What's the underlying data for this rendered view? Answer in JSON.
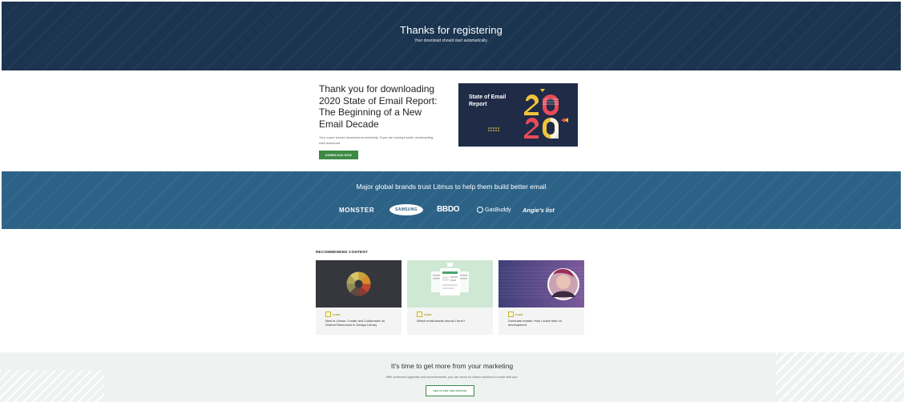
{
  "hero": {
    "title": "Thanks for registering",
    "subtitle": "Your download should start automatically."
  },
  "download": {
    "title": "Thank you for downloading 2020 State of Email Report: The Beginning of a New Email Decade",
    "text": "Your report should download momentarily. If you are having trouble downloading, click download.",
    "button_label": "DOWNLOAD NOW",
    "report_card": {
      "title": "State of Email Report",
      "digits": [
        "2",
        "0",
        "2",
        "0"
      ]
    }
  },
  "brands": {
    "title": "Major global brands trust Litmus to help them build better email",
    "logos": [
      "MONSTER",
      "SAMSUNG",
      "BBDO",
      "GasBuddy",
      "Angie's list"
    ]
  },
  "recommended": {
    "title": "RECOMMENDED CONTENT",
    "cards": [
      {
        "badge": "GUIDE",
        "text": "New in Litmus: Create and Collaborate on Shared Resources in Design Library",
        "image_icon": "color-wheel-icon"
      },
      {
        "badge": "GUIDE",
        "text": "Which email teams should I form?",
        "image_icon": "ui-mockup-icon"
      },
      {
        "badge": "GUIDE",
        "text": "Dominate emails: How I solve time on development",
        "image_icon": "portrait-icon"
      }
    ]
  },
  "cta": {
    "title": "It's time to get more from your marketing",
    "subtitle": "With continued upgrades and enhancements, you can count on Litmus solutions to scale with you.",
    "button_label": "SEE PLANS AND PRICING"
  },
  "colors": {
    "hero_bg": "#1b3450",
    "brands_bg": "#2d6287",
    "accent_green": "#3d8a45",
    "report_bg": "#202b48"
  }
}
